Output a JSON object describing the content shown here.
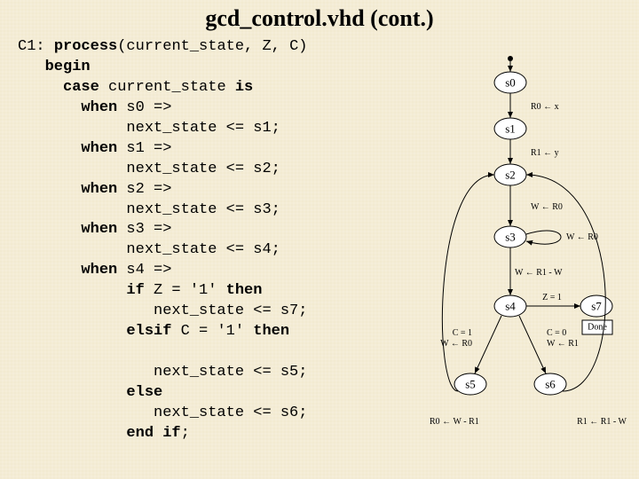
{
  "title": "gcd_control.vhd  (cont.)",
  "code": {
    "l1a": "C1: ",
    "l1b": "process",
    "l1c": "(current_state, Z, C)",
    "l2": "   begin",
    "l3a": "     ",
    "l3b": "case",
    "l3c": " current_state ",
    "l3d": "is",
    "l4a": "       ",
    "l4b": "when",
    "l4c": " s0 =>",
    "l5": "            next_state <= s1;",
    "l6a": "       ",
    "l6b": "when",
    "l6c": " s1 =>",
    "l7": "            next_state <= s2;",
    "l8a": "       ",
    "l8b": "when",
    "l8c": " s2 =>",
    "l9": "            next_state <= s3;",
    "l10a": "       ",
    "l10b": "when",
    "l10c": " s3 =>",
    "l11": "            next_state <= s4;",
    "l12a": "       ",
    "l12b": "when",
    "l12c": " s4 =>",
    "l13a": "            ",
    "l13b": "if",
    "l13c": " Z = '1' ",
    "l13d": "then",
    "l14": "               next_state <= s7;",
    "l15a": "            ",
    "l15b": "elsif",
    "l15c": " C = '1' ",
    "l15d": "then",
    "blank": " ",
    "l16": "               next_state <= s5;",
    "l17a": "            ",
    "l17b": "else",
    "l18": "               next_state <= s6;",
    "l19a": "            ",
    "l19b": "end if",
    "l19c": ";"
  },
  "diagram": {
    "states": {
      "s0": "s0",
      "s1": "s1",
      "s2": "s2",
      "s3": "s3",
      "s4": "s4",
      "s5": "s5",
      "s6": "s6",
      "s7": "s7"
    },
    "done": "Done",
    "edges": {
      "e01": "R0 ← x",
      "e12": "R1 ← y",
      "e23": "W ← R0",
      "e34": "W ← R1 - W",
      "e44": "W ← R0",
      "e47z": "Z = 1",
      "e45c1": "C = 1",
      "e45w": "W ← R0",
      "e46c0": "C = 0",
      "e46w": "W ← R1",
      "e53": "R0 ← W - R1",
      "e63": "R1 ← R1 - W"
    }
  }
}
